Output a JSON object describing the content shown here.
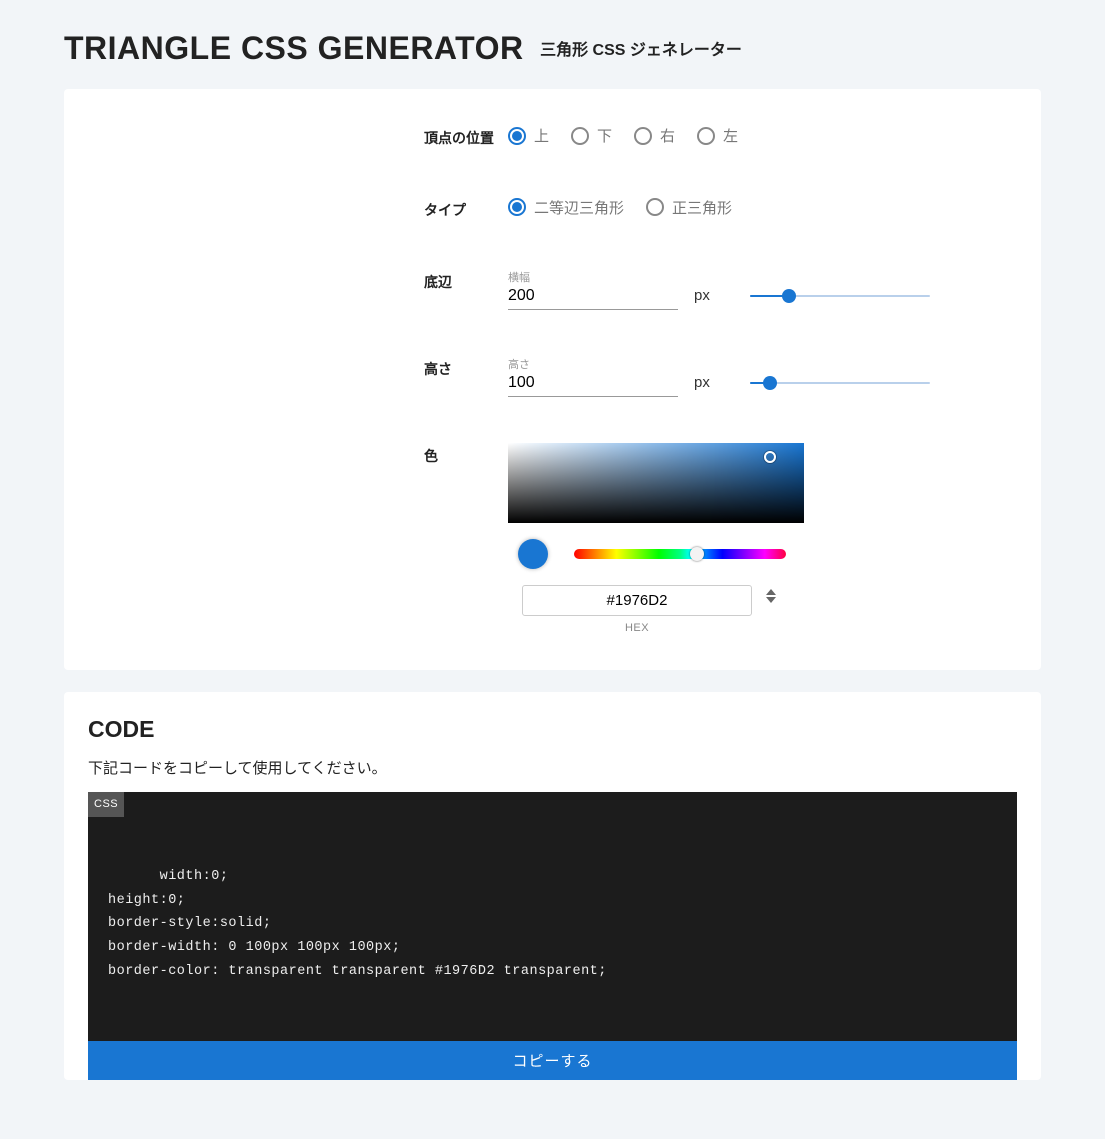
{
  "header": {
    "title": "TRIANGLE CSS GENERATOR",
    "subtitle": "三角形 CSS ジェネレーター"
  },
  "form": {
    "vertex": {
      "label": "頂点の位置",
      "options": [
        {
          "label": "上",
          "selected": true
        },
        {
          "label": "下",
          "selected": false
        },
        {
          "label": "右",
          "selected": false
        },
        {
          "label": "左",
          "selected": false
        }
      ]
    },
    "type": {
      "label": "タイプ",
      "options": [
        {
          "label": "二等辺三角形",
          "selected": true
        },
        {
          "label": "正三角形",
          "selected": false
        }
      ]
    },
    "base": {
      "label": "底辺",
      "field_label": "横幅",
      "value": "200",
      "unit": "px",
      "slider_percent": 22
    },
    "height": {
      "label": "高さ",
      "field_label": "高さ",
      "value": "100",
      "unit": "px",
      "slider_percent": 11
    },
    "color": {
      "label": "色",
      "hex_value": "#1976D2",
      "hex_label": "HEX",
      "swatch": "#1976D2",
      "hue_thumb_percent": 58
    }
  },
  "code": {
    "title": "CODE",
    "description": "下記コードをコピーして使用してください。",
    "lang_badge": "CSS",
    "content": "width:0;\nheight:0;\nborder-style:solid;\nborder-width: 0 100px 100px 100px;\nborder-color: transparent transparent #1976D2 transparent;",
    "copy_button": "コピーする"
  }
}
